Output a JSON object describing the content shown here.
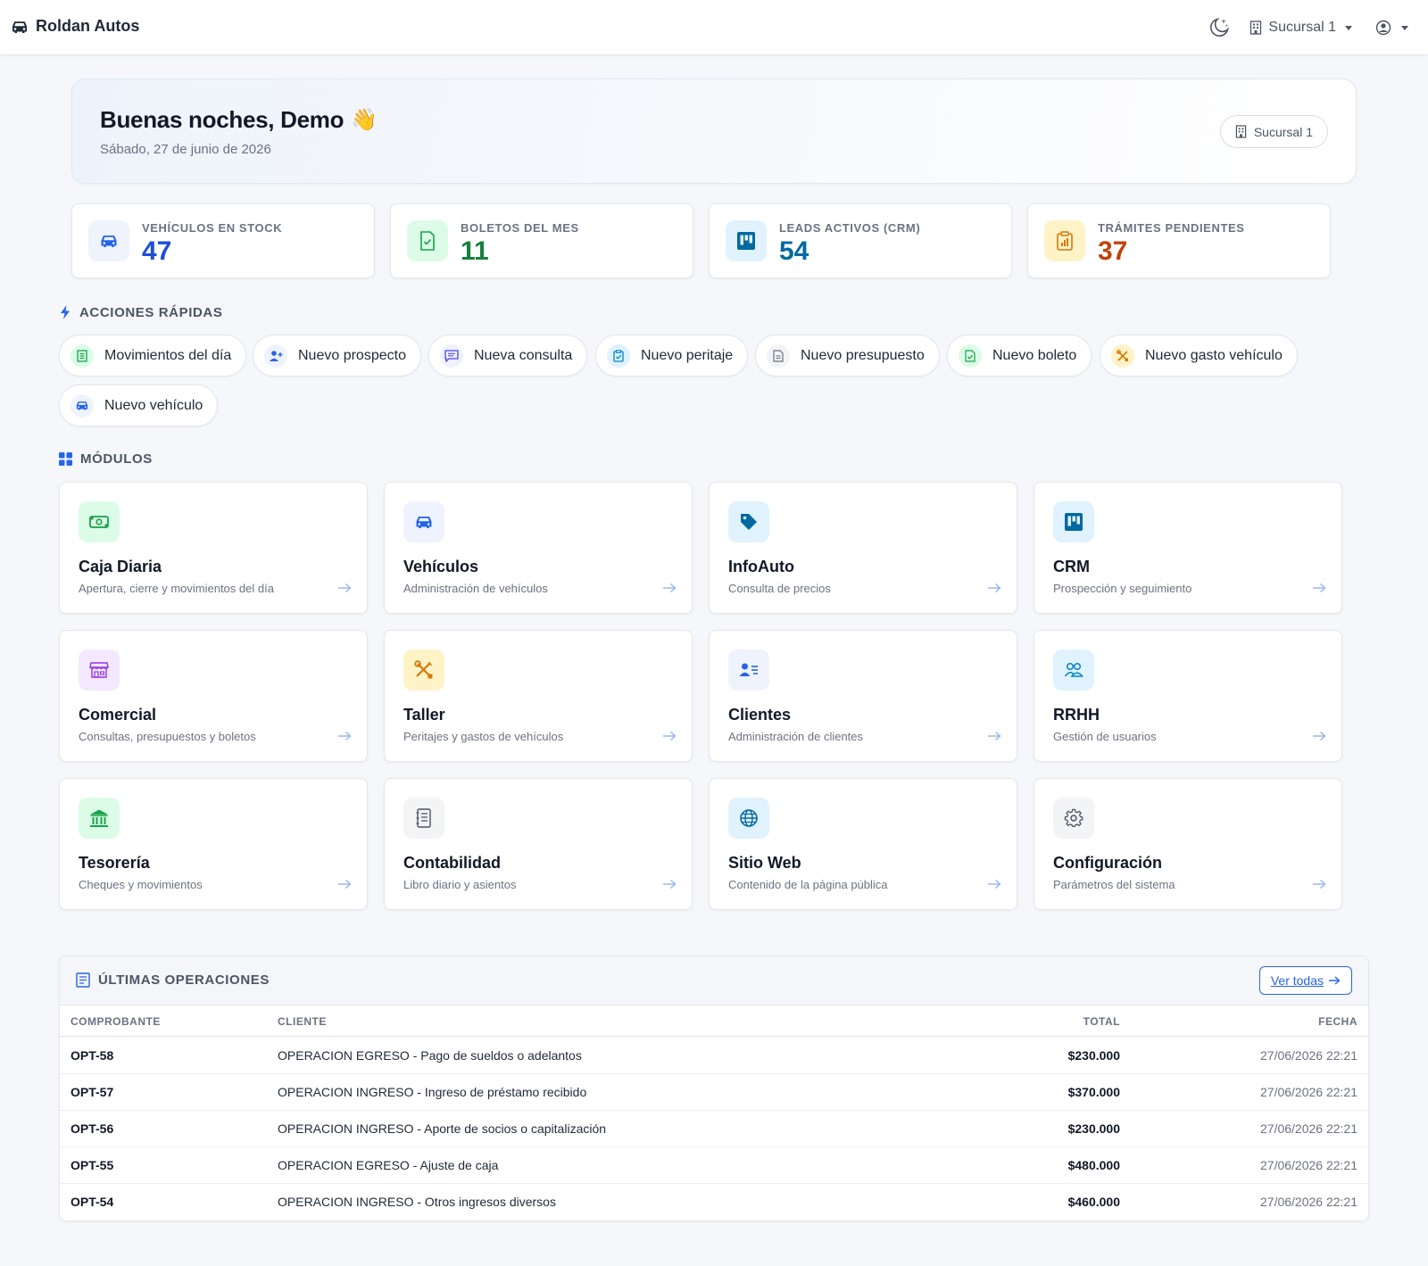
{
  "navbar": {
    "brand": "Roldan Autos",
    "branch": "Sucursal 1"
  },
  "greeting": {
    "title": "Buenas noches, Demo",
    "emoji": "👋",
    "date": "Sábado, 27 de junio de 2026",
    "branch_pill": "Sucursal 1"
  },
  "stats": [
    {
      "label": "VEHÍCULOS EN STOCK",
      "value": "47",
      "color": "#1d4ed8",
      "bg": "#eef3fd",
      "icon": "car-icon"
    },
    {
      "label": "BOLETOS DEL MES",
      "value": "11",
      "color": "#15803d",
      "bg": "#dcfce7",
      "icon": "document-check-icon"
    },
    {
      "label": "LEADS ACTIVOS (CRM)",
      "value": "54",
      "color": "#0369a1",
      "bg": "#e0f2fe",
      "icon": "kanban-icon"
    },
    {
      "label": "TRÁMITES PENDIENTES",
      "value": "37",
      "color": "#c2410c",
      "bg": "#fef3c7",
      "icon": "clipboard-chart-icon"
    }
  ],
  "quick_actions": {
    "title": "ACCIONES RÁPIDAS",
    "items": [
      {
        "label": "Movimientos del día",
        "icon": "receipt-icon"
      },
      {
        "label": "Nuevo prospecto",
        "icon": "person-plus-icon"
      },
      {
        "label": "Nueva consulta",
        "icon": "chat-icon"
      },
      {
        "label": "Nuevo peritaje",
        "icon": "clipboard-check-icon"
      },
      {
        "label": "Nuevo presupuesto",
        "icon": "file-text-icon"
      },
      {
        "label": "Nuevo boleto",
        "icon": "document-check-icon"
      },
      {
        "label": "Nuevo gasto vehículo",
        "icon": "tools-icon"
      },
      {
        "label": "Nuevo vehículo",
        "icon": "car-icon"
      }
    ]
  },
  "modules": {
    "title": "MÓDULOS",
    "items": [
      {
        "title": "Caja Diaria",
        "desc": "Apertura, cierre y movimientos del día",
        "icon": "cash-icon"
      },
      {
        "title": "Vehículos",
        "desc": "Administración de vehículos",
        "icon": "car-icon"
      },
      {
        "title": "InfoAuto",
        "desc": "Consulta de precios",
        "icon": "tag-icon"
      },
      {
        "title": "CRM",
        "desc": "Prospección y seguimiento",
        "icon": "kanban-icon"
      },
      {
        "title": "Comercial",
        "desc": "Consultas, presupuestos y boletos",
        "icon": "shop-icon"
      },
      {
        "title": "Taller",
        "desc": "Peritajes y gastos de vehículos",
        "icon": "tools-icon"
      },
      {
        "title": "Clientes",
        "desc": "Administración de clientes",
        "icon": "person-lines-icon"
      },
      {
        "title": "RRHH",
        "desc": "Gestión de usuarios",
        "icon": "people-icon"
      },
      {
        "title": "Tesorería",
        "desc": "Cheques y movimientos",
        "icon": "bank-icon"
      },
      {
        "title": "Contabilidad",
        "desc": "Libro diario y asientos",
        "icon": "journal-icon"
      },
      {
        "title": "Sitio Web",
        "desc": "Contenido de la página pública",
        "icon": "globe-icon"
      },
      {
        "title": "Configuración",
        "desc": "Parámetros del sistema",
        "icon": "gear-icon"
      }
    ]
  },
  "operations": {
    "title": "ÚLTIMAS OPERACIONES",
    "view_all": "Ver todas",
    "columns": [
      "COMPROBANTE",
      "CLIENTE",
      "TOTAL",
      "FECHA"
    ],
    "rows": [
      {
        "comprobante": "OPT-58",
        "cliente": "OPERACION EGRESO - Pago de sueldos o adelantos",
        "total": "$230.000",
        "fecha": "27/06/2026 22:21"
      },
      {
        "comprobante": "OPT-57",
        "cliente": "OPERACION INGRESO - Ingreso de préstamo recibido",
        "total": "$370.000",
        "fecha": "27/06/2026 22:21"
      },
      {
        "comprobante": "OPT-56",
        "cliente": "OPERACION INGRESO - Aporte de socios o capitalización",
        "total": "$230.000",
        "fecha": "27/06/2026 22:21"
      },
      {
        "comprobante": "OPT-55",
        "cliente": "OPERACION EGRESO - Ajuste de caja",
        "total": "$480.000",
        "fecha": "27/06/2026 22:21"
      },
      {
        "comprobante": "OPT-54",
        "cliente": "OPERACION INGRESO - Otros ingresos diversos",
        "total": "$460.000",
        "fecha": "27/06/2026 22:21"
      }
    ]
  }
}
